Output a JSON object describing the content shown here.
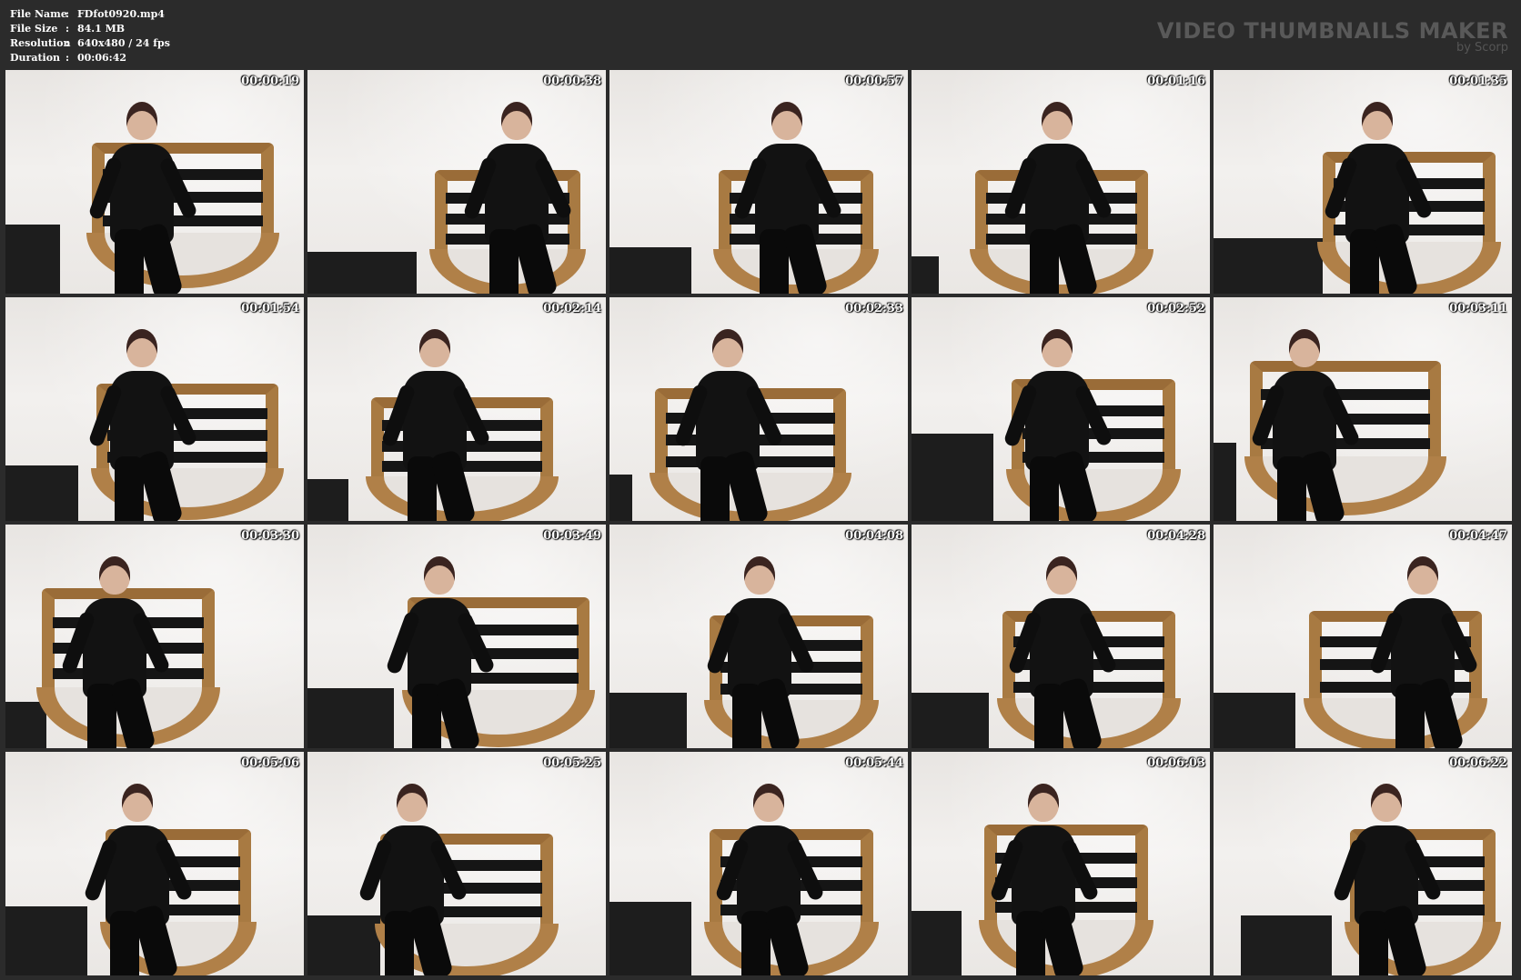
{
  "info": {
    "rows": [
      {
        "label": "File Name",
        "value": "FDfot0920.mp4"
      },
      {
        "label": "File Size",
        "value": "84.1 MB"
      },
      {
        "label": "Resolution",
        "value": "640x480 / 24 fps"
      },
      {
        "label": "Duration",
        "value": "00:06:42"
      }
    ],
    "separator": ":"
  },
  "brand": {
    "title": "VIDEO THUMBNAILS MAKER",
    "subtitle": "by Scorp"
  },
  "thumbnails": [
    {
      "timestamp": "00:00:19"
    },
    {
      "timestamp": "00:00:38"
    },
    {
      "timestamp": "00:00:57"
    },
    {
      "timestamp": "00:01:16"
    },
    {
      "timestamp": "00:01:35"
    },
    {
      "timestamp": "00:01:54"
    },
    {
      "timestamp": "00:02:14"
    },
    {
      "timestamp": "00:02:33"
    },
    {
      "timestamp": "00:02:52"
    },
    {
      "timestamp": "00:03:11"
    },
    {
      "timestamp": "00:03:30"
    },
    {
      "timestamp": "00:03:49"
    },
    {
      "timestamp": "00:04:08"
    },
    {
      "timestamp": "00:04:28"
    },
    {
      "timestamp": "00:04:47"
    },
    {
      "timestamp": "00:05:06"
    },
    {
      "timestamp": "00:05:25"
    },
    {
      "timestamp": "00:05:44"
    },
    {
      "timestamp": "00:06:03"
    },
    {
      "timestamp": "00:06:22"
    }
  ],
  "colors": {
    "background": "#2b2b2b",
    "brand_text": "#595959",
    "wood": "#a87a42"
  }
}
